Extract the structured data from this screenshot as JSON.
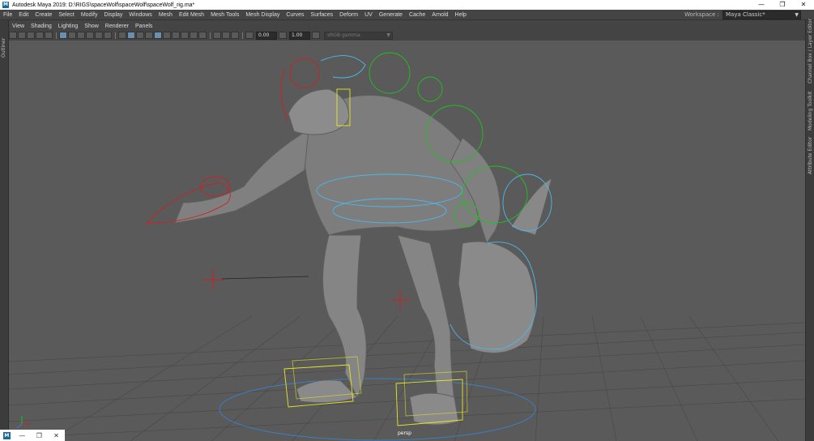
{
  "window": {
    "title": "Autodesk Maya 2019: D:\\RIGS\\spaceWolf\\spaceWolf\\spaceWolf_rig.ma*",
    "minimize": "—",
    "maximize": "❐",
    "close": "✕"
  },
  "menubar": [
    "File",
    "Edit",
    "Create",
    "Select",
    "Modify",
    "Display",
    "Windows",
    "Mesh",
    "Edit Mesh",
    "Mesh Tools",
    "Mesh Display",
    "Curves",
    "Surfaces",
    "Deform",
    "UV",
    "Generate",
    "Cache",
    "Arnold",
    "Help"
  ],
  "workspace": {
    "label": "Workspace :",
    "value": "Maya Classic*"
  },
  "left_strip": {
    "label": "Outliner"
  },
  "right_strip": {
    "tabs": [
      "Channel Box / Layer Editor",
      "Modeling Toolkit",
      "Attribute Editor"
    ]
  },
  "panel_menu": [
    "View",
    "Shading",
    "Lighting",
    "Show",
    "Renderer",
    "Panels"
  ],
  "panel_toolbar": {
    "exposure": "0.00",
    "gamma": "1.00",
    "color_space": "sRGB gamma"
  },
  "viewport": {
    "camera": "persp"
  },
  "minibar": {
    "restore": "❐",
    "close": "✕",
    "minimize": "—"
  },
  "colors": {
    "background": "#5a5a5a",
    "ik_red": "#d02020",
    "ctrl_green": "#20c020",
    "ctrl_blue": "#4db8e8",
    "box_yellow": "#e8e820"
  }
}
